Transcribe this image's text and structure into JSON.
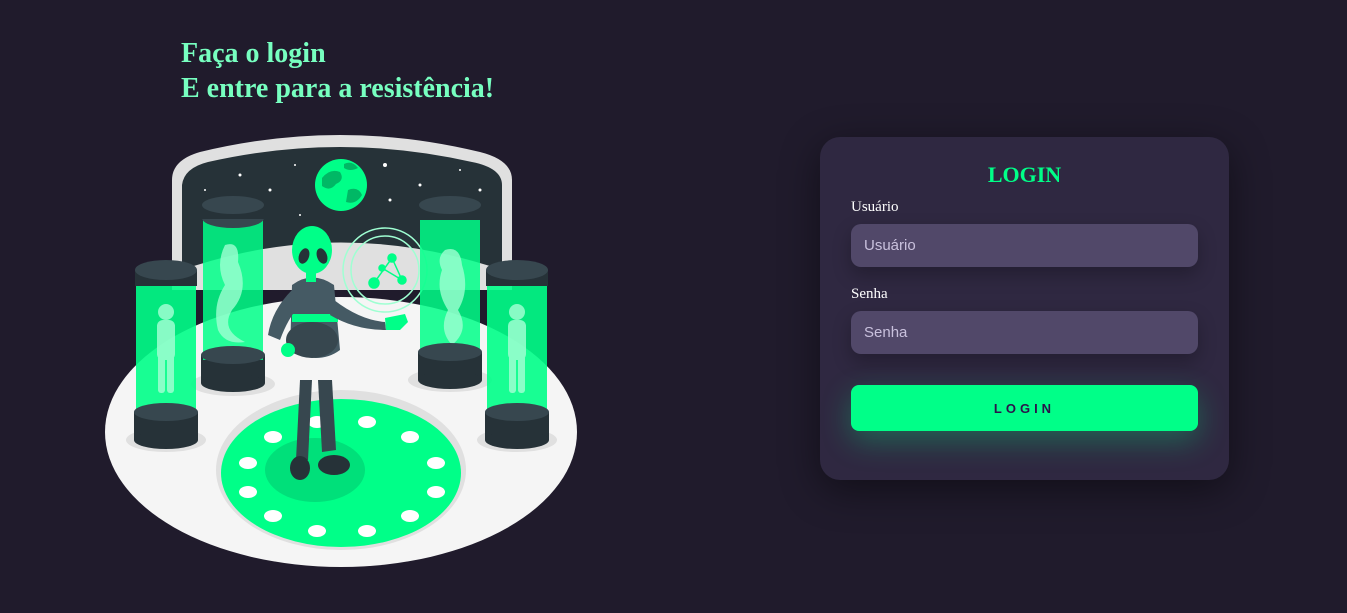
{
  "headline": {
    "line1": "Faça o login",
    "line2": "E entre para a resistência!"
  },
  "illustration": {
    "icon": "alien-lab-illustration",
    "colors": {
      "accent": "#00ff88",
      "floor": "#f4f4f4",
      "dark": "#263238"
    }
  },
  "login_card": {
    "title": "LOGIN",
    "username": {
      "label": "Usuário",
      "placeholder": "Usuário",
      "value": ""
    },
    "password": {
      "label": "Senha",
      "placeholder": "Senha",
      "value": ""
    },
    "submit_label": "LOGIN"
  },
  "colors": {
    "background": "#201b2c",
    "card": "#2f2841",
    "input": "#514869",
    "accent": "#00ff88",
    "headline": "#77ffc0"
  }
}
